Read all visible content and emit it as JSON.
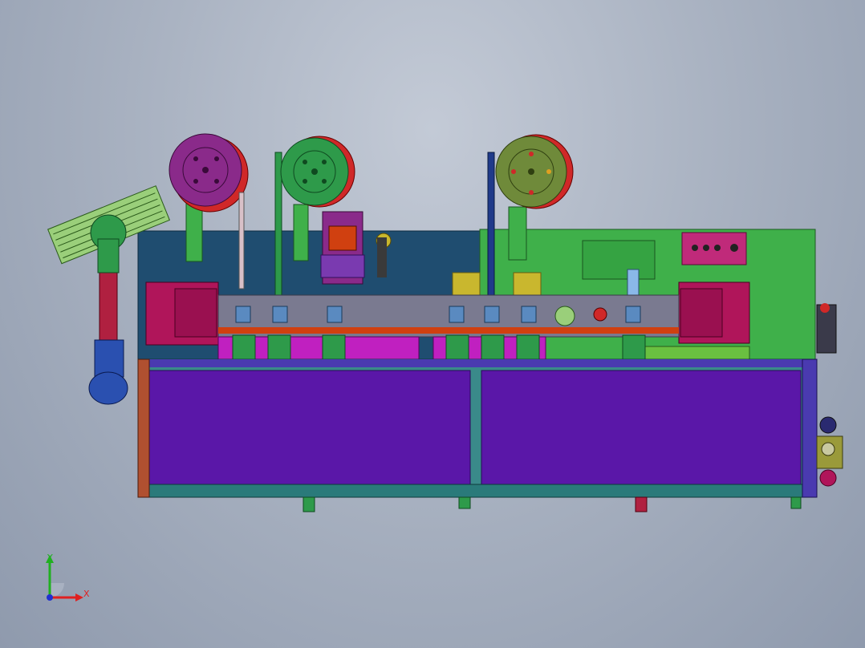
{
  "triad": {
    "x_label": "X",
    "y_label": "Y",
    "x_color": "#e02020",
    "y_color": "#20b020",
    "z_color": "#2030d0"
  },
  "colors": {
    "frame": "#3a8a8a",
    "left_panel": "#1f4d70",
    "right_panel": "#3fb04a",
    "cover": "#5a17a8",
    "motor_magenta": "#b0155a",
    "reel_red": "#d02828",
    "reel_purple": "#8a2a8a",
    "reel_green": "#2e9a4a",
    "reel_olive": "#6f8a3a"
  },
  "components": [
    "left-feeder-reel",
    "middle-feeder-reel",
    "right-feeder-reel",
    "robot-arm",
    "gripper-rack",
    "left-servo-motor",
    "right-servo-motor",
    "control-panel",
    "front-cover",
    "right-connector-block"
  ]
}
